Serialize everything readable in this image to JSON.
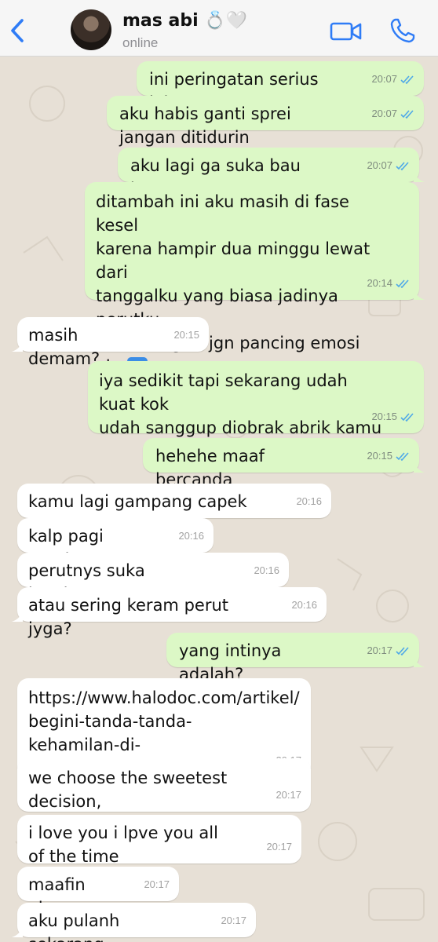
{
  "header": {
    "contact_name": "mas abi 💍🤍",
    "status": "online",
    "icons": [
      "back-chevron-icon",
      "avatar",
      "video-camera-icon",
      "phone-icon"
    ],
    "accent_color": "#2f7cf6"
  },
  "messages": [
    {
      "dir": "out",
      "text": "ini peringatan serius loh",
      "time": "20:07"
    },
    {
      "dir": "out",
      "text": "aku habis ganti sprei jangan ditidurin",
      "time": "20:07"
    },
    {
      "dir": "out",
      "text": "aku lagi ga suka bau kamu",
      "time": "20:07"
    },
    {
      "dir": "out",
      "text": "ditambah ini aku masih di fase kesel\nkarena hampir dua minggu lewat dari\ntanggalku yang biasa jadinya perutku\nsakit banget, jgn pancing emosi aku",
      "emoji": "OK",
      "time": "20:14"
    },
    {
      "dir": "in",
      "text": "masih demam?",
      "time": "20:15"
    },
    {
      "dir": "out",
      "text": "iya sedikit tapi sekarang udah kuat kok\nudah sanggup diobrak abrik kamu",
      "time": "20:15"
    },
    {
      "dir": "out",
      "text": "hehehe maaf bercanda",
      "time": "20:15"
    },
    {
      "dir": "in",
      "text": "kamu lagi gampang capek ga?",
      "time": "20:16"
    },
    {
      "dir": "in",
      "text": "kalp pagi mual?",
      "time": "20:16"
    },
    {
      "dir": "in",
      "text": "perutnys suka kembung?",
      "time": "20:16"
    },
    {
      "dir": "in",
      "text": "atau sering keram perut jyga?",
      "time": "20:16"
    },
    {
      "dir": "out",
      "text": "yang intinya adalah?",
      "time": "20:17"
    },
    {
      "dir": "in",
      "text": "https://www.halodoc.com/artikel/\nbegini-tanda-tanda-kehamilan-di-\nminggu-pertama",
      "time": "20:17"
    },
    {
      "dir": "in",
      "text": "we choose the sweetest decision,\nnardheena",
      "time": "20:17"
    },
    {
      "dir": "in",
      "text": "i love you i lpve you all of the time",
      "time": "20:17"
    },
    {
      "dir": "in",
      "text": "maafin aku",
      "time": "20:17"
    },
    {
      "dir": "in",
      "text": "aku pulanh sekarang",
      "time": "20:17"
    }
  ],
  "colors": {
    "outgoing_bubble": "#dcf8c6",
    "incoming_bubble": "#ffffff",
    "read_ticks": "#4fa9e8",
    "chat_background": "#e7e0d6"
  }
}
